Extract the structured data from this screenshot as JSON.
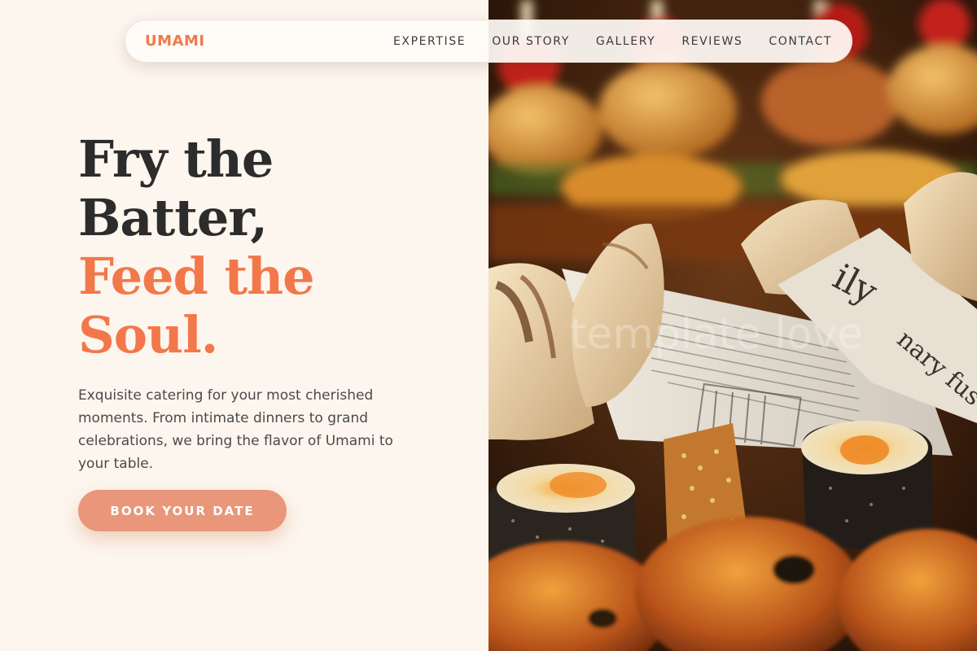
{
  "nav": {
    "brand": "UMAMI",
    "links": [
      "EXPERTISE",
      "OUR STORY",
      "GALLERY",
      "REVIEWS",
      "CONTACT"
    ]
  },
  "hero": {
    "headline_line1": "Fry the",
    "headline_line2": "Batter,",
    "headline_line3": "Feed the",
    "headline_line4": "Soul.",
    "description": "Exquisite catering for your most cherished moments. From intimate dinners to grand celebrations, we bring the flavor of Umami to your table.",
    "cta_label": "BOOK YOUR DATE",
    "image_watermark": "template love"
  },
  "colors": {
    "background": "#fdf6ee",
    "accent": "#f2784b",
    "brand": "#f07a4a",
    "cta": "#e9967a",
    "heading_dark": "#2c2c2c"
  },
  "icons": []
}
